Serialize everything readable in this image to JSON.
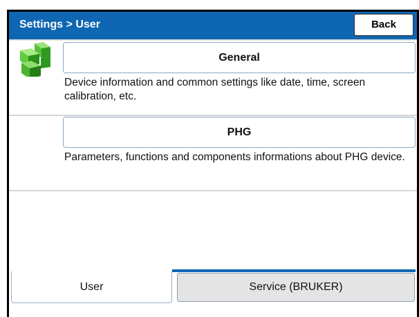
{
  "header": {
    "title": "Settings > User",
    "back_label": "Back",
    "accent_color": "#0f66b3"
  },
  "items": [
    {
      "label": "General",
      "description": "Device information and common settings like date, time, screen calibration, etc.",
      "icon": "green-cubes-icon"
    },
    {
      "label": "PHG",
      "description": "Parameters, functions and components informations about PHG device."
    }
  ],
  "tabs": [
    {
      "label": "User",
      "active": true
    },
    {
      "label": "Service (BRUKER)",
      "active": false
    }
  ]
}
